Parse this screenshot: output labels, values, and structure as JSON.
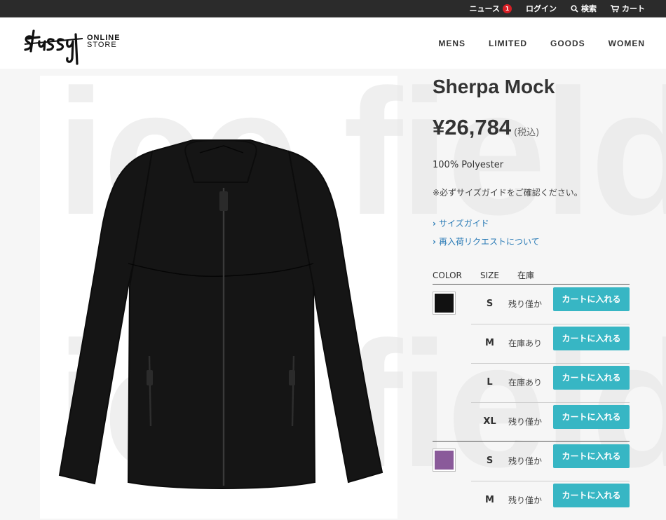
{
  "topbar": {
    "news": "ニュース",
    "news_count": "1",
    "login": "ログイン",
    "search": "検索",
    "cart": "カート"
  },
  "header": {
    "logo_line1": "ONLINE",
    "logo_line2": "STORE",
    "nav": [
      "MENS",
      "LIMITED",
      "GOODS",
      "WOMEN"
    ]
  },
  "watermark": "ice field",
  "product": {
    "title": "Sherpa Mock",
    "price": "¥26,784",
    "tax": "(税込)",
    "material": "100% Polyester",
    "note": "※必ずサイズガイドをご確認ください。",
    "size_guide": "サイズガイド",
    "restock": "再入荷リクエストについて"
  },
  "stock_table": {
    "headers": {
      "color": "COLOR",
      "size": "SIZE",
      "stock": "在庫"
    },
    "cart_label": "カートに入れる",
    "rows": [
      {
        "size": "S",
        "stock": "残り僅か"
      },
      {
        "size": "M",
        "stock": "在庫あり"
      },
      {
        "size": "L",
        "stock": "在庫あり"
      },
      {
        "size": "XL",
        "stock": "残り僅か"
      },
      {
        "size": "S",
        "stock": "残り僅か"
      },
      {
        "size": "M",
        "stock": "残り僅か"
      }
    ],
    "colors": [
      "#111111",
      "#8a5a9a"
    ]
  },
  "accent_color": "#37b6c4"
}
